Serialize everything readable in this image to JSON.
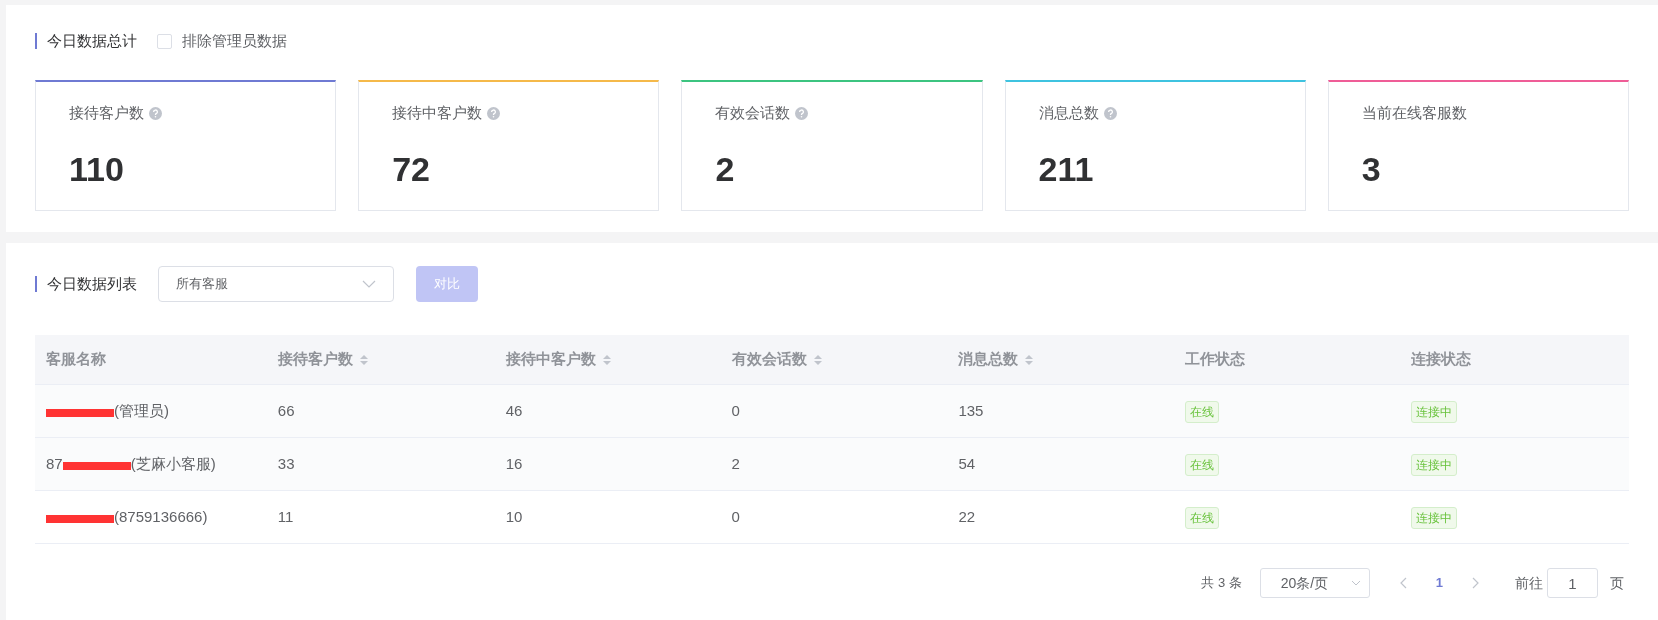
{
  "summary": {
    "title": "今日数据总计",
    "exclude_admin": {
      "label": "排除管理员数据",
      "checked": false
    },
    "cards": [
      {
        "label": "接待客户数",
        "value": "110",
        "help": true,
        "color": "#6f7ad3"
      },
      {
        "label": "接待中客户数",
        "value": "72",
        "help": true,
        "color": "#f5b94a"
      },
      {
        "label": "有效会话数",
        "value": "2",
        "help": true,
        "color": "#3cc480"
      },
      {
        "label": "消息总数",
        "value": "211",
        "help": true,
        "color": "#3fc3e0"
      },
      {
        "label": "当前在线客服数",
        "value": "3",
        "help": false,
        "color": "#ef5d97"
      }
    ]
  },
  "list": {
    "title": "今日数据列表",
    "agent_select": {
      "value": "所有客服"
    },
    "compare_button": {
      "label": "对比",
      "disabled": true
    },
    "table": {
      "columns": [
        {
          "label": "客服名称",
          "sortable": false
        },
        {
          "label": "接待客户数",
          "sortable": true
        },
        {
          "label": "接待中客户数",
          "sortable": true
        },
        {
          "label": "有效会话数",
          "sortable": true
        },
        {
          "label": "消息总数",
          "sortable": true
        },
        {
          "label": "工作状态",
          "sortable": false
        },
        {
          "label": "连接状态",
          "sortable": false
        }
      ],
      "rows": [
        {
          "redacted": true,
          "cells": [
            {
              "after": "(管理员)"
            },
            "66",
            "46",
            "0",
            "135",
            "在线",
            "连接中"
          ]
        },
        {
          "redacted": true,
          "cells": [
            {
              "before": "87",
              "after": "(芝麻小客服)"
            },
            "33",
            "16",
            "2",
            "54",
            "在线",
            "连接中"
          ]
        },
        {
          "redacted": true,
          "cells": [
            {
              "after": "(8759136666)"
            },
            "11",
            "10",
            "0",
            "22",
            "在线",
            "连接中"
          ]
        }
      ]
    },
    "pagination": {
      "total": "共 3 条",
      "page_size": "20条/页",
      "pages": [
        {
          "label": "1",
          "selected": true
        }
      ],
      "goto_label": "前往",
      "goto_value": "1",
      "page_suffix": "页"
    }
  }
}
